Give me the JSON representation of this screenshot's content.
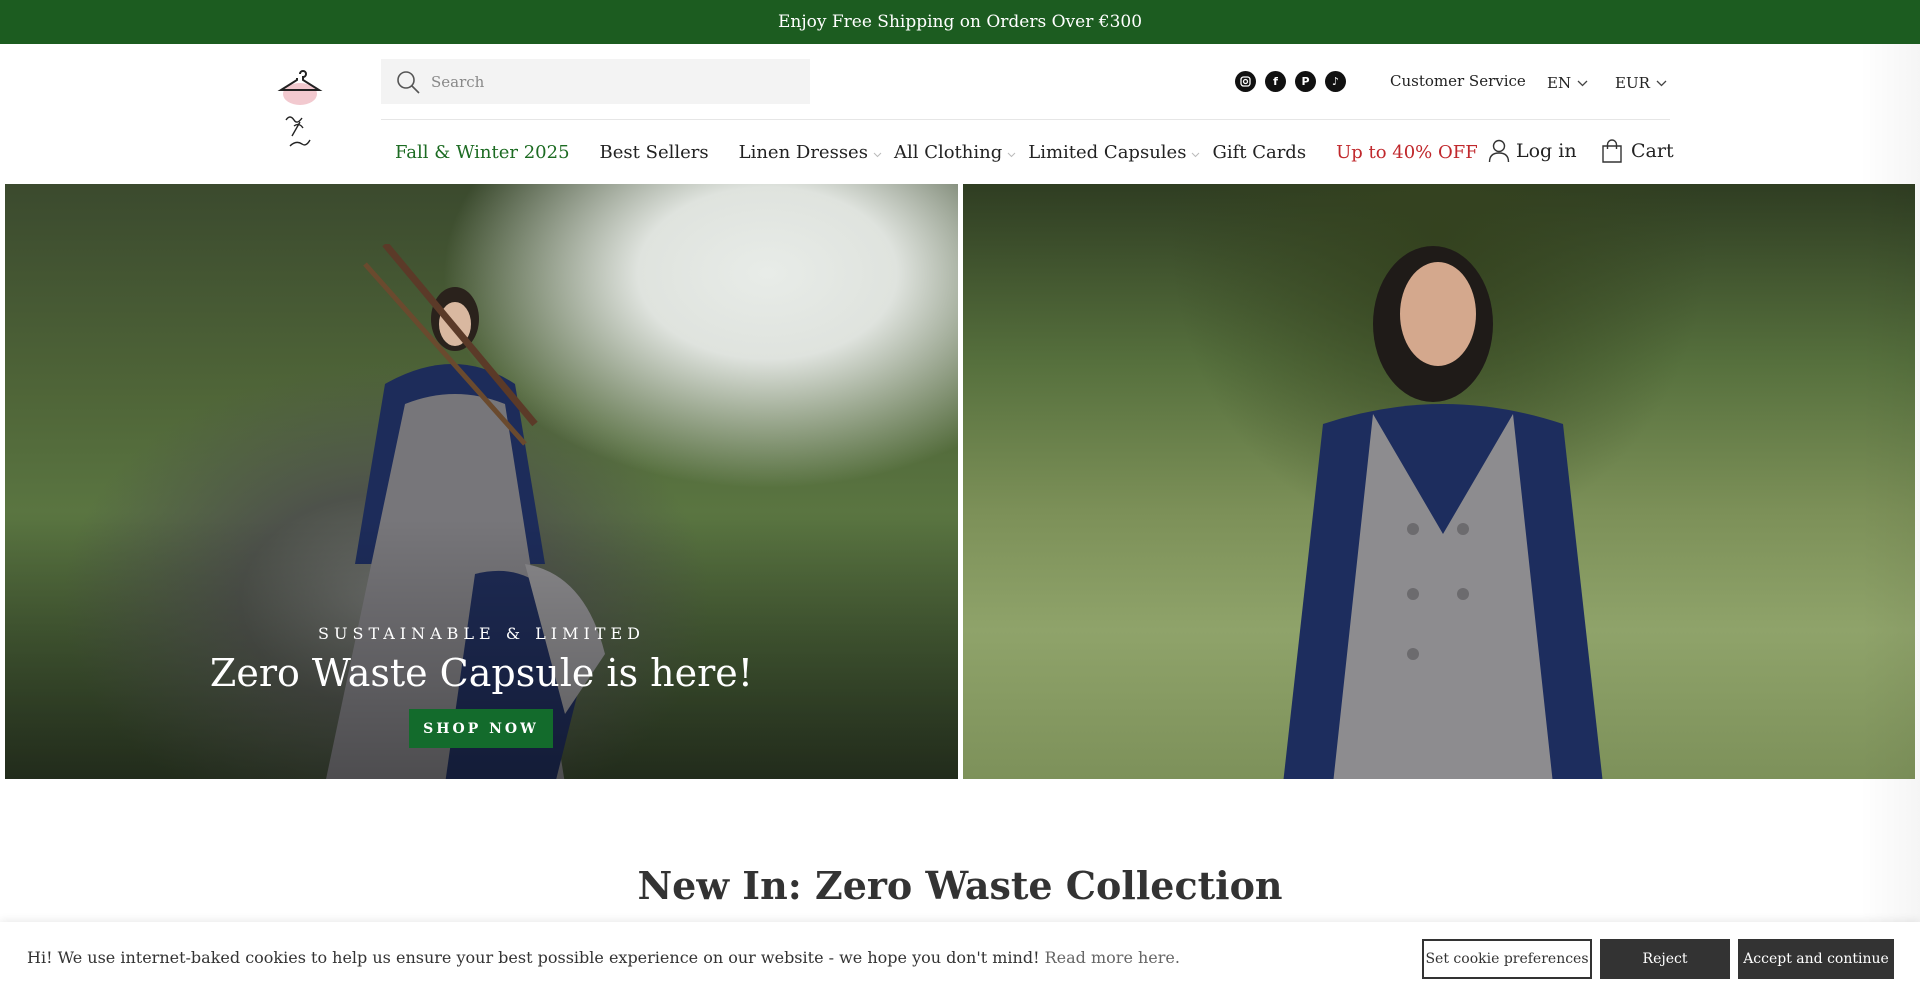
{
  "announcement": {
    "text": "Enjoy Free Shipping on Orders Over €300"
  },
  "brand": {
    "logo_icon": "hanger-logo-icon",
    "accent": "#1c5c20"
  },
  "search": {
    "placeholder": "Search"
  },
  "socials": [
    {
      "icon": "instagram-icon"
    },
    {
      "icon": "facebook-icon"
    },
    {
      "icon": "pinterest-icon"
    },
    {
      "icon": "tiktok-icon"
    }
  ],
  "utility": {
    "customer_service": "Customer Service",
    "language": "EN",
    "currency": "EUR"
  },
  "nav": {
    "items": [
      {
        "label": "Fall & Winter 2025",
        "style": "green"
      },
      {
        "label": "Best Sellers",
        "style": "normal"
      },
      {
        "label": "Linen Dresses",
        "style": "normal",
        "dropdown": true
      },
      {
        "label": "All Clothing",
        "style": "normal",
        "dropdown": true
      },
      {
        "label": "Limited Capsules",
        "style": "normal",
        "dropdown": true
      },
      {
        "label": "Gift Cards",
        "style": "normal"
      },
      {
        "label": "Up to 40% OFF",
        "style": "red"
      }
    ],
    "login": "Log in",
    "cart": "Cart"
  },
  "hero": {
    "kicker": "SUSTAINABLE & LIMITED",
    "headline": "Zero Waste Capsule is here!",
    "cta": "SHOP NOW",
    "cta_color": "#136b2c"
  },
  "section": {
    "title": "New In: Zero Waste Collection"
  },
  "cookie": {
    "message": "Hi! We use internet-baked cookies to help us ensure your best possible experience on our website - we hope you don't mind!",
    "read_more": "Read more here.",
    "preferences": "Set cookie preferences",
    "reject": "Reject",
    "accept": "Accept and continue"
  }
}
